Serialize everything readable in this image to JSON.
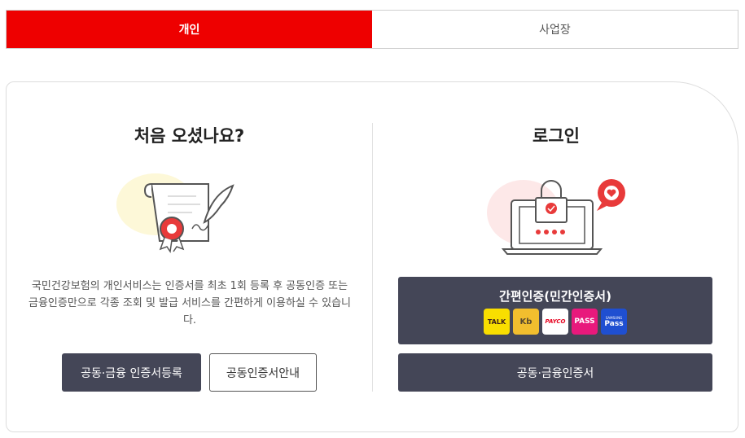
{
  "tabs": [
    {
      "label": "개인",
      "active": true
    },
    {
      "label": "사업장",
      "active": false
    }
  ],
  "left": {
    "title": "처음 오셨나요?",
    "description": "국민건강보험의 개인서비스는 인증서를 최초 1회 등록 후 공동인증 또는 금융인증만으로 각종 조회 및 발급 서비스를 간편하게 이용하실 수 있습니다.",
    "register_button": "공동·금융 인증서등록",
    "guide_button": "공동인증서안내"
  },
  "right": {
    "title": "로그인",
    "simple_auth_label": "간편인증(민간인증서)",
    "providers": [
      {
        "name": "kakao-talk",
        "text": "TALK"
      },
      {
        "name": "kb",
        "text": "Kb"
      },
      {
        "name": "payco",
        "text": "PAYCO"
      },
      {
        "name": "pass",
        "text": "PASS"
      },
      {
        "name": "samsung-pass",
        "text": "Pass",
        "subtext": "SAMSUNG"
      }
    ],
    "cert_button": "공동·금융인증서"
  },
  "colors": {
    "brand_red": "#ee0000",
    "button_dark": "#444657"
  }
}
